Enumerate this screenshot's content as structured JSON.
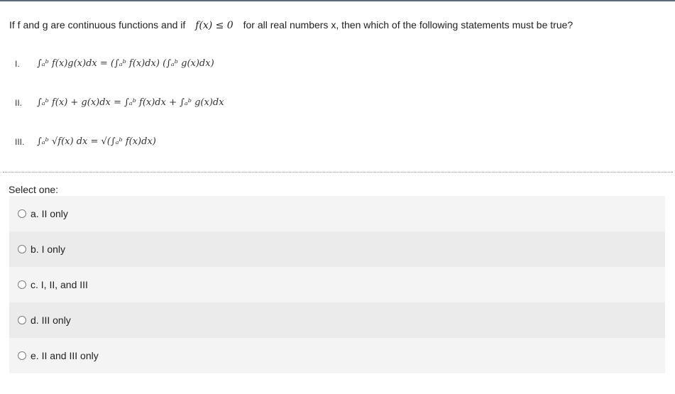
{
  "question": {
    "text_before": "If f and g are continuous functions and if",
    "condition": "f(x) ≤ 0",
    "text_after": "for all real numbers x, then which of the following statements must be true?"
  },
  "statements": [
    {
      "num": "I.",
      "formula": "∫ₐᵇ f(x)g(x)dx = (∫ₐᵇ f(x)dx) (∫ₐᵇ g(x)dx)"
    },
    {
      "num": "II.",
      "formula": "∫ₐᵇ f(x) + g(x)dx = ∫ₐᵇ f(x)dx + ∫ₐᵇ g(x)dx"
    },
    {
      "num": "III.",
      "formula": "∫ₐᵇ √f(x) dx = √(∫ₐᵇ f(x)dx)"
    }
  ],
  "select_label": "Select one:",
  "options": [
    {
      "label": "a. II only"
    },
    {
      "label": "b. I only"
    },
    {
      "label": "c. I, II, and III"
    },
    {
      "label": "d. III only"
    },
    {
      "label": "e. II and III only"
    }
  ]
}
